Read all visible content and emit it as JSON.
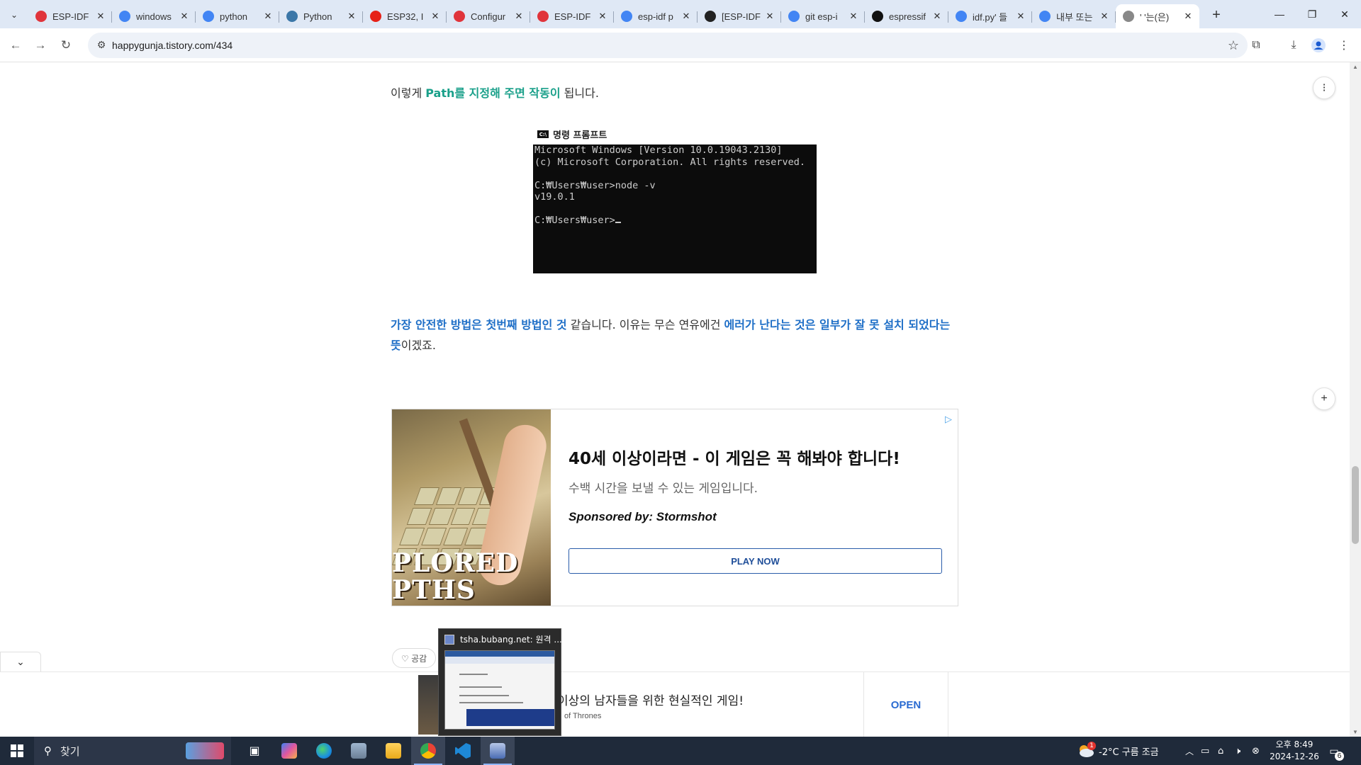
{
  "browser": {
    "tabs": [
      {
        "title": "ESP-IDF",
        "favicon": "espressif-icon",
        "color": "#e0343b",
        "active": false
      },
      {
        "title": "windows",
        "favicon": "google-icon",
        "color": "#4285f4",
        "active": false
      },
      {
        "title": "python",
        "favicon": "google-icon",
        "color": "#4285f4",
        "active": false
      },
      {
        "title": "Python",
        "favicon": "python-icon",
        "color": "#3b77a8",
        "active": false
      },
      {
        "title": "ESP32, I",
        "favicon": "youtube-icon",
        "color": "#e62117",
        "active": false
      },
      {
        "title": "Configur",
        "favicon": "espressif-icon",
        "color": "#e0343b",
        "active": false
      },
      {
        "title": "ESP-IDF",
        "favicon": "espressif-icon",
        "color": "#e0343b",
        "active": false
      },
      {
        "title": "esp-idf p",
        "favicon": "google-icon",
        "color": "#4285f4",
        "active": false
      },
      {
        "title": "[ESP-IDF",
        "favicon": "blog-icon",
        "color": "#222222",
        "active": false
      },
      {
        "title": "git esp-i",
        "favicon": "google-icon",
        "color": "#4285f4",
        "active": false
      },
      {
        "title": "espressif",
        "favicon": "github-icon",
        "color": "#111111",
        "active": false
      },
      {
        "title": "idf.py' 들",
        "favicon": "google-icon",
        "color": "#4285f4",
        "active": false
      },
      {
        "title": "내부 또는",
        "favicon": "google-icon",
        "color": "#4285f4",
        "active": false
      },
      {
        "title": "' '는(은)",
        "favicon": "tistory-icon",
        "color": "#888888",
        "active": true
      }
    ],
    "close_glyph": "✕",
    "new_tab_glyph": "+",
    "url": "happygunja.tistory.com/434",
    "window_controls": {
      "minimize": "—",
      "restore": "❐",
      "close": "✕"
    }
  },
  "article": {
    "para1": {
      "before": "이렇게 ",
      "highlight": "Path를 지정해 주면 작동이",
      "after": " 됩니다."
    },
    "cmd_window": {
      "title": "명령 프롬프트",
      "icon_text": "C:\\",
      "lines": [
        "Microsoft Windows [Version 10.0.19043.2130]",
        "(c) Microsoft Corporation. All rights reserved.",
        "",
        "C:₩Users₩user>node -v",
        "v19.0.1",
        "",
        "C:₩Users₩user>"
      ]
    },
    "para2": {
      "hl1": "가장 안전한 방법은 첫번째 방법인 것",
      "mid": " 같습니다. 이유는 무슨 연유에건 ",
      "hl2": "에러가 난다는 것은 일부가 잘 못 설치 되었다는 뜻",
      "end": "이겠죠."
    },
    "like_label": "♡ 공감"
  },
  "ad": {
    "headline": "40세 이상이라면 - 이 게임은 꼭 해봐야 합니다!",
    "description": "수백 시간을 보낼 수 있는 게임입니다.",
    "sponsor": "Sponsored by: Stormshot",
    "cta": "PLAY NOW",
    "image_text": "PLORED\nPTHS",
    "adchoices_icon": "▷"
  },
  "bottom_ad": {
    "text": "이상의 남자들을 위한 현실적인 게임!",
    "sub": "of Thrones",
    "open": "OPEN"
  },
  "preview_popup": {
    "title": "tsha.bubang.net: 원격 ..."
  },
  "taskbar": {
    "search_label": "찾기",
    "weather": "-2°C  구름 조금",
    "weather_badge": "1",
    "time": "오후 8:49",
    "date": "2024-12-26",
    "notifications": "6"
  }
}
